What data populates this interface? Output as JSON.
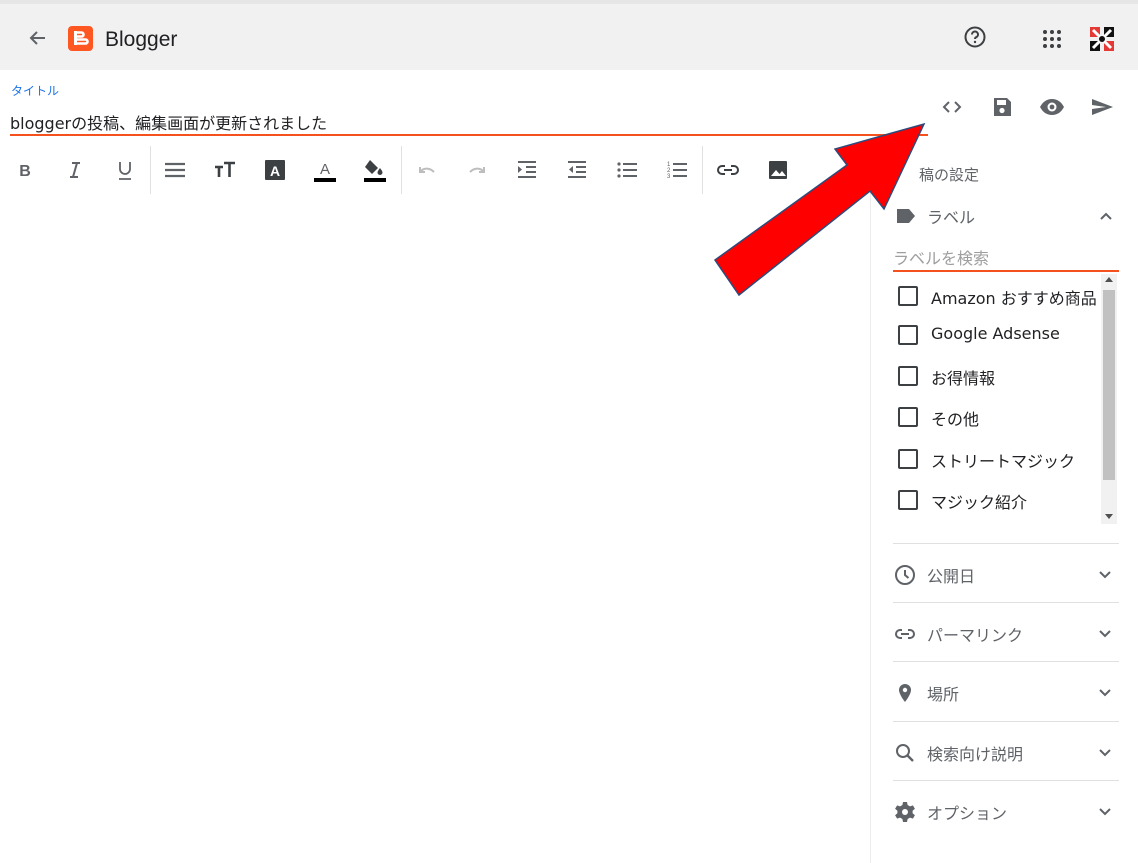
{
  "header": {
    "app_title": "Blogger",
    "back_icon": "arrow-back-icon",
    "help_icon": "help-circle-icon",
    "apps_icon": "apps-grid-icon",
    "avatar_icon": "account-avatar"
  },
  "editor": {
    "title_label": "タイトル",
    "title_value": "bloggerの投稿、編集画面が更新されました"
  },
  "top_actions": [
    "html-view-icon",
    "save-icon",
    "preview-icon",
    "publish-icon"
  ],
  "toolbar": [
    "bold",
    "italic",
    "underline",
    "paragraph-style",
    "font-size",
    "text-color",
    "font-color",
    "highlight-color",
    "undo",
    "redo",
    "indent",
    "outdent",
    "bulleted-list",
    "numbered-list",
    "link",
    "image"
  ],
  "settings": {
    "heading": "稿の設定",
    "labels": {
      "title": "ラベル",
      "search_placeholder": "ラベルを検索",
      "items": [
        "Amazon おすすめ商品",
        "Google Adsense",
        "お得情報",
        "その他",
        "ストリートマジック",
        "マジック紹介"
      ]
    },
    "sections": [
      "公開日",
      "パーマリンク",
      "場所",
      "検索向け説明",
      "オプション"
    ]
  },
  "colors": {
    "accent": "#f4511e",
    "title_label": "#1a73e8",
    "blogger_orange": "#ff5722",
    "annotation_arrow": "#ff0000"
  }
}
